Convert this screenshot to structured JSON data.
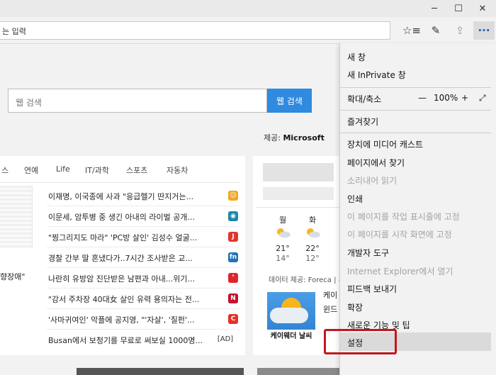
{
  "window": {
    "min": "─",
    "max": "☐",
    "close": "✕"
  },
  "toolbar": {
    "address_text": "는 입력",
    "fav_icon": "☆≡",
    "note_icon": "✎",
    "share_icon": "⇪",
    "more_icon": "···"
  },
  "search": {
    "placeholder": "웹 검색",
    "button": "웹 검색"
  },
  "provider": {
    "prefix": "제공: ",
    "name": "Microsoft"
  },
  "news": {
    "categories": [
      "스",
      "연예",
      "Life",
      "IT/과학",
      "스포츠",
      "자동차"
    ],
    "caption": "향장애\"",
    "items": [
      {
        "title": "이재명, 이국종에 사과 \"응급헬기 딴지거는...",
        "source_color": "#f0a820",
        "source_icon": "☺"
      },
      {
        "title": "이문세, 암투병 중 생긴 아내의 라이벌 공개...",
        "source_color": "#1a8aa8",
        "source_icon": "◉"
      },
      {
        "title": "\"찡그리지도 마라\" 'PC방 살인' 김성수 얼굴...",
        "source_color": "#e2352b",
        "source_icon": "J"
      },
      {
        "title": "경찰 간부 딸 혼냈다가..7시간 조사받은 교...",
        "source_color": "#1e73be",
        "source_icon": "fn"
      },
      {
        "title": "나란히 유방암 진단받은 남편과 아내...위기...",
        "source_color": "#e0242c",
        "source_icon": "❜"
      },
      {
        "title": "\"강서 주차장 40대女 살인 유력 용의자는 전...",
        "source_color": "#c8102e",
        "source_icon": "N"
      },
      {
        "title": "'사마귀여인' 악플에 공지영, \"'자살', '질펀'...",
        "source_color": "#e63027",
        "source_icon": "C"
      },
      {
        "title": "Busan에서 보청기를 무료로 써보실 1000명...",
        "source_color": "",
        "source_icon": "[AD]"
      }
    ]
  },
  "weather": {
    "days": [
      {
        "day": "월",
        "high": "21°",
        "low": "14°"
      },
      {
        "day": "화",
        "high": "22°",
        "low": "12°"
      }
    ],
    "credit": "데이터 제공: Foreca | 유",
    "image_label": "케이웨더 날씨",
    "text1": "케이",
    "text2": "윈드"
  },
  "menu": {
    "items": [
      {
        "label": "새 창",
        "disabled": false
      },
      {
        "label": "새 InPrivate 창",
        "disabled": false
      },
      {
        "label": "확대/축소",
        "disabled": false
      },
      {
        "label": "즐겨찾기",
        "disabled": false
      },
      {
        "label": "장치에 미디어 캐스트",
        "disabled": false
      },
      {
        "label": "페이지에서 찾기",
        "disabled": false
      },
      {
        "label": "소리내어 읽기",
        "disabled": true
      },
      {
        "label": "인쇄",
        "disabled": false
      },
      {
        "label": "이 페이지를 작업 표시줄에 고정",
        "disabled": true
      },
      {
        "label": "이 페이지를 시작 화면에 고정",
        "disabled": true
      },
      {
        "label": "개발자 도구",
        "disabled": false
      },
      {
        "label": "Internet Explorer에서 열기",
        "disabled": true
      },
      {
        "label": "피드백 보내기",
        "disabled": false
      },
      {
        "label": "확장",
        "disabled": false
      },
      {
        "label": "새로운 기능 및 팁",
        "disabled": false
      },
      {
        "label": "설정",
        "disabled": false
      }
    ],
    "zoom": {
      "minus": "—",
      "value": "100%",
      "plus": "+",
      "fullscreen": "⤢"
    }
  },
  "colors": {
    "accent": "#2f8ae0",
    "highlight": "#c0171d"
  }
}
